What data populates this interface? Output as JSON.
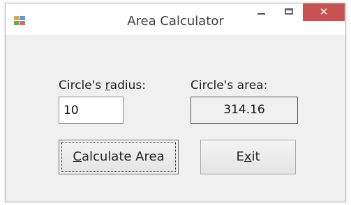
{
  "window": {
    "title": "Area Calculator",
    "icon": "app-form-icon",
    "controls": {
      "minimize_icon": "minimize-icon",
      "maximize_icon": "maximize-icon",
      "close_label": "✕",
      "close_color": "#c75050"
    }
  },
  "form": {
    "radius_label_pre": "Circle's ",
    "radius_label_accel": "r",
    "radius_label_post": "adius:",
    "radius_value": "10",
    "area_label": "Circle's area:",
    "area_value": "314.16",
    "calculate_pre": "",
    "calculate_accel": "C",
    "calculate_post": "alculate Area",
    "exit_pre": "E",
    "exit_accel": "x",
    "exit_post": "it"
  }
}
